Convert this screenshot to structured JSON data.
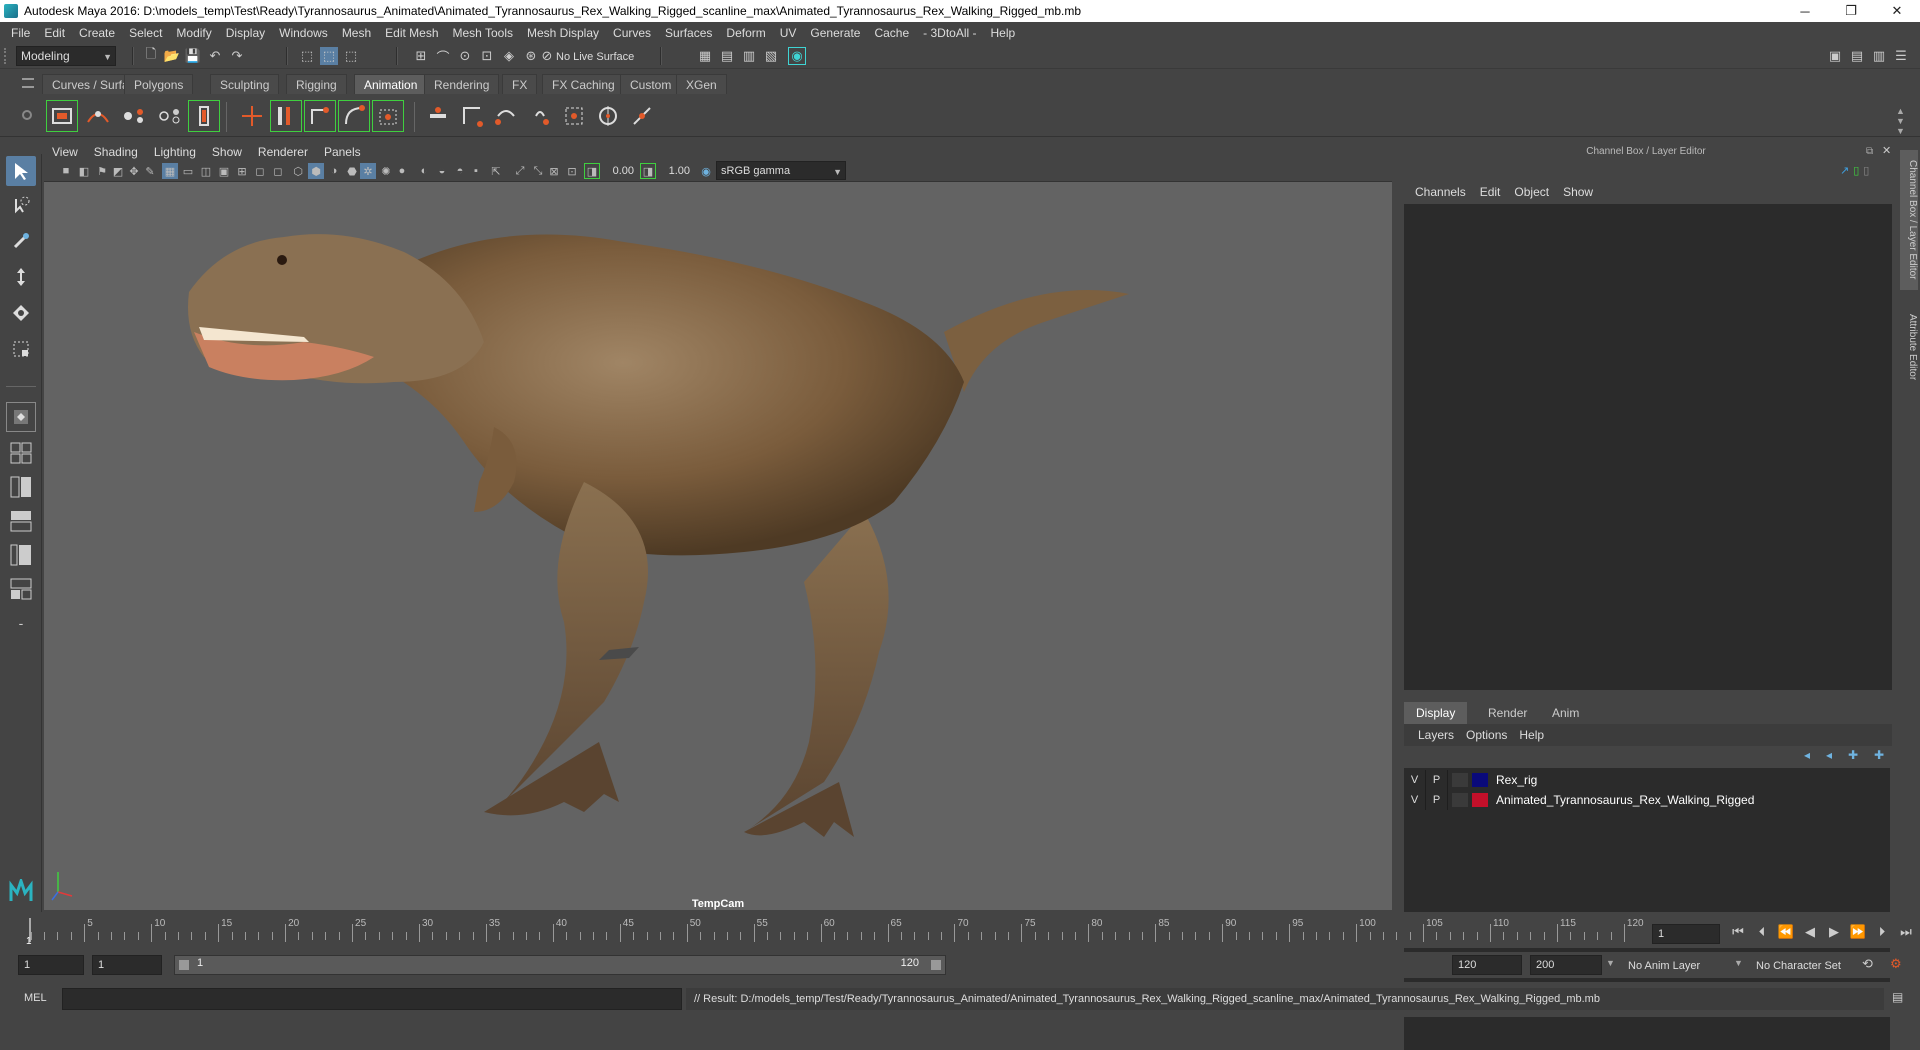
{
  "window": {
    "title": "Autodesk Maya 2016: D:\\models_temp\\Test\\Ready\\Tyrannosaurus_Animated\\Animated_Tyrannosaurus_Rex_Walking_Rigged_scanline_max\\Animated_Tyrannosaurus_Rex_Walking_Rigged_mb.mb",
    "minimize": "─",
    "restore": "❐",
    "close": "✕"
  },
  "menubar": [
    "File",
    "Edit",
    "Create",
    "Select",
    "Modify",
    "Display",
    "Windows",
    "Mesh",
    "Edit Mesh",
    "Mesh Tools",
    "Mesh Display",
    "Curves",
    "Surfaces",
    "Deform",
    "UV",
    "Generate",
    "Cache",
    "- 3DtoAll -",
    "Help"
  ],
  "statusline": {
    "mode": "Modeling",
    "live_surface": "No Live Surface"
  },
  "shelf_tabs": [
    {
      "label": "Curves / Surfaces",
      "active": false
    },
    {
      "label": "Polygons",
      "active": false
    },
    {
      "label": "Sculpting",
      "active": false
    },
    {
      "label": "Rigging",
      "active": false
    },
    {
      "label": "Animation",
      "active": true
    },
    {
      "label": "Rendering",
      "active": false
    },
    {
      "label": "FX",
      "active": false
    },
    {
      "label": "FX Caching",
      "active": false
    },
    {
      "label": "Custom",
      "active": false
    },
    {
      "label": "XGen",
      "active": false
    }
  ],
  "viewport": {
    "menu": [
      "View",
      "Shading",
      "Lighting",
      "Show",
      "Renderer",
      "Panels"
    ],
    "exposure": "0.00",
    "gamma": "1.00",
    "color_space": "sRGB gamma",
    "camera": "TempCam"
  },
  "channel_box": {
    "header": "Channel Box / Layer Editor",
    "menu": [
      "Channels",
      "Edit",
      "Object",
      "Show"
    ]
  },
  "layer_editor": {
    "tabs": [
      {
        "label": "Display",
        "active": true
      },
      {
        "label": "Render",
        "active": false
      },
      {
        "label": "Anim",
        "active": false
      }
    ],
    "menu": [
      "Layers",
      "Options",
      "Help"
    ],
    "layers": [
      {
        "v": "V",
        "p": "P",
        "color": "#0a0a7a",
        "name": "Rex_rig"
      },
      {
        "v": "V",
        "p": "P",
        "color": "#c4102a",
        "name": "Animated_Tyrannosaurus_Rex_Walking_Rigged"
      }
    ]
  },
  "side_tabs": [
    "Channel Box / Layer Editor",
    "Attribute Editor"
  ],
  "timeline": {
    "ticks": [
      5,
      10,
      15,
      20,
      25,
      30,
      35,
      40,
      45,
      50,
      55,
      60,
      65,
      70,
      75,
      80,
      85,
      90,
      95,
      100,
      105,
      110,
      115,
      120
    ],
    "start_label": "1",
    "current_frame": "1",
    "min": 1,
    "max": 120
  },
  "range": {
    "start": "1",
    "playback_start": "1",
    "slider_start": "1",
    "slider_end": "120",
    "playback_end": "120",
    "end": "200",
    "anim_layer": "No Anim Layer",
    "character_set": "No Character Set"
  },
  "command_line": {
    "type": "MEL",
    "result": "// Result: D:/models_temp/Test/Ready/Tyrannosaurus_Animated/Animated_Tyrannosaurus_Rex_Walking_Rigged_scanline_max/Animated_Tyrannosaurus_Rex_Walking_Rigged_mb.mb"
  }
}
